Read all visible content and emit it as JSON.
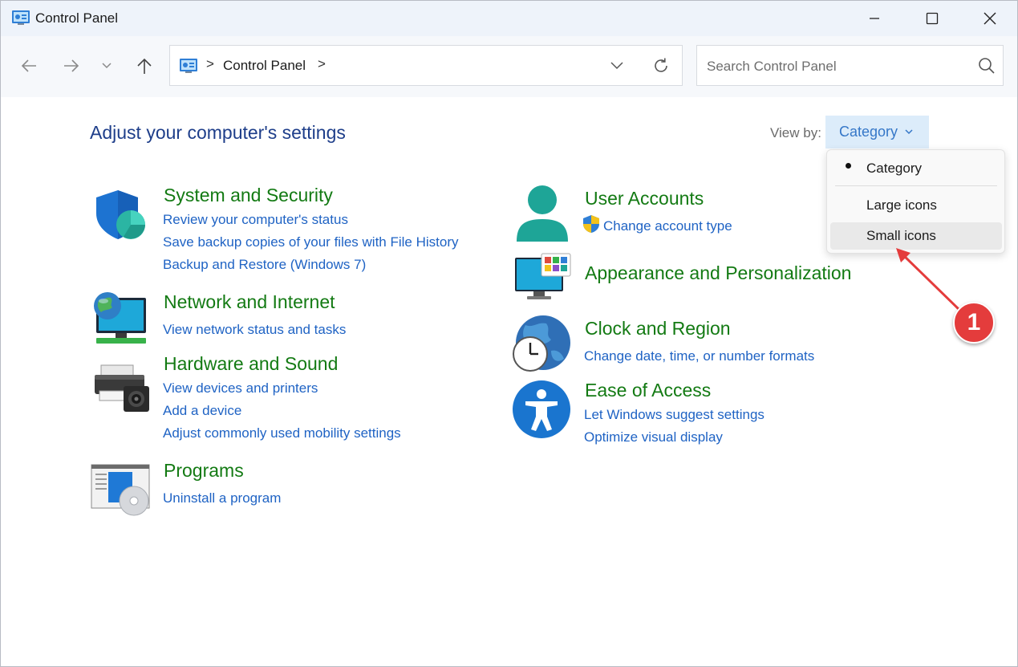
{
  "window": {
    "title": "Control Panel"
  },
  "address": {
    "separator": ">",
    "path": "Control Panel"
  },
  "search": {
    "placeholder": "Search Control Panel"
  },
  "main": {
    "heading": "Adjust your computer's settings",
    "view_by_label": "View by:",
    "view_by_value": "Category"
  },
  "dropdown": {
    "items": [
      "Category",
      "Large icons",
      "Small icons"
    ],
    "selected": "Category",
    "hovered": "Small icons"
  },
  "annotation": {
    "number": "1"
  },
  "categories": {
    "system_security": {
      "title": "System and Security",
      "links": [
        "Review your computer's status",
        "Save backup copies of your files with File History",
        "Backup and Restore (Windows 7)"
      ]
    },
    "network": {
      "title": "Network and Internet",
      "links": [
        "View network status and tasks"
      ]
    },
    "hardware": {
      "title": "Hardware and Sound",
      "links": [
        "View devices and printers",
        "Add a device",
        "Adjust commonly used mobility settings"
      ]
    },
    "programs": {
      "title": "Programs",
      "links": [
        "Uninstall a program"
      ]
    },
    "user_accounts": {
      "title": "User Accounts",
      "links": [
        "Change account type"
      ]
    },
    "appearance": {
      "title": "Appearance and Personalization",
      "links": []
    },
    "clock": {
      "title": "Clock and Region",
      "links": [
        "Change date, time, or number formats"
      ]
    },
    "ease": {
      "title": "Ease of Access",
      "links": [
        "Let Windows suggest settings",
        "Optimize visual display"
      ]
    }
  },
  "colors": {
    "heading": "#1e3e8a",
    "category_title": "#137a13",
    "link": "#1f63c4",
    "viewby_bg": "#dcecfa",
    "annotation_red": "#e43c3c"
  }
}
